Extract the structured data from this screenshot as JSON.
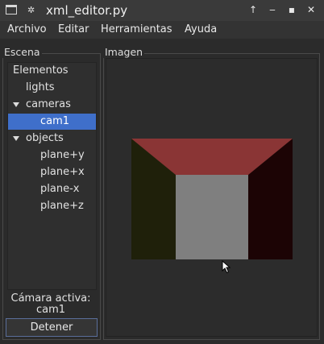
{
  "window": {
    "title": "xml_editor.py"
  },
  "menu": {
    "items": [
      "Archivo",
      "Editar",
      "Herramientas",
      "Ayuda"
    ]
  },
  "scene": {
    "group_label": "Escena",
    "tree": [
      {
        "label": "Elementos",
        "level": 0,
        "expanded": null,
        "selected": false
      },
      {
        "label": "lights",
        "level": 1,
        "expanded": null,
        "selected": false
      },
      {
        "label": "cameras",
        "level": 1,
        "expanded": true,
        "selected": false
      },
      {
        "label": "cam1",
        "level": 2,
        "expanded": null,
        "selected": true
      },
      {
        "label": "objects",
        "level": 1,
        "expanded": true,
        "selected": false
      },
      {
        "label": "plane+y",
        "level": 2,
        "expanded": null,
        "selected": false
      },
      {
        "label": "plane+x",
        "level": 2,
        "expanded": null,
        "selected": false
      },
      {
        "label": "plane-x",
        "level": 2,
        "expanded": null,
        "selected": false
      },
      {
        "label": "plane+z",
        "level": 2,
        "expanded": null,
        "selected": false
      }
    ],
    "active_camera_label": "Cámara activa:",
    "active_camera_value": "cam1",
    "stop_button": "Detener"
  },
  "image": {
    "group_label": "Imagen",
    "colors": {
      "ceiling": "#8a3535",
      "left_wall": "#1f200a",
      "right_wall": "#1c0405",
      "back_wall": "#7f7f7f"
    }
  }
}
